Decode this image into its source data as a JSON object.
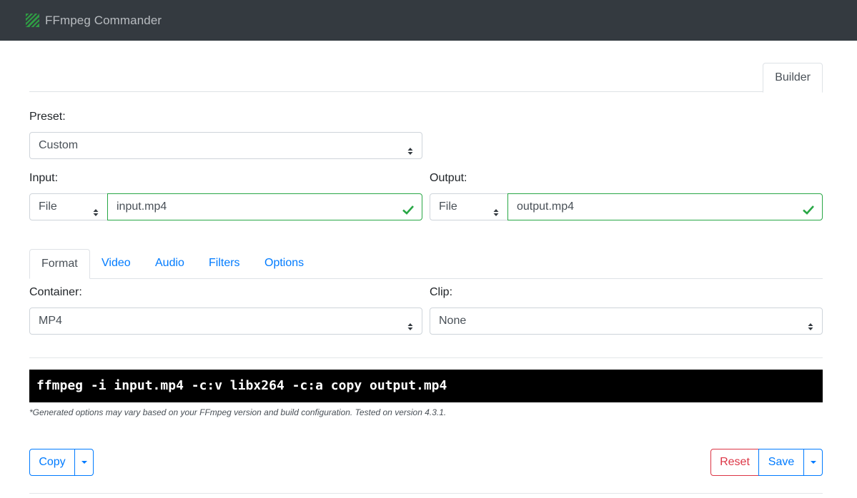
{
  "app": {
    "title": "FFmpeg Commander"
  },
  "top_tabs": {
    "builder": "Builder"
  },
  "preset": {
    "label": "Preset:",
    "value": "Custom"
  },
  "input": {
    "label": "Input:",
    "type": "File",
    "value": "input.mp4"
  },
  "output": {
    "label": "Output:",
    "type": "File",
    "value": "output.mp4"
  },
  "tabs": [
    {
      "label": "Format",
      "active": true
    },
    {
      "label": "Video",
      "active": false
    },
    {
      "label": "Audio",
      "active": false
    },
    {
      "label": "Filters",
      "active": false
    },
    {
      "label": "Options",
      "active": false
    }
  ],
  "format": {
    "container_label": "Container:",
    "container_value": "MP4",
    "clip_label": "Clip:",
    "clip_value": "None"
  },
  "command": "ffmpeg -i input.mp4 -c:v libx264 -c:a copy output.mp4",
  "note": "*Generated options may vary based on your FFmpeg version and build configuration. Tested on version 4.3.1.",
  "buttons": {
    "copy": "Copy",
    "reset": "Reset",
    "save": "Save"
  },
  "colors": {
    "navbar": "#343a40",
    "primary": "#007bff",
    "success": "#28a745",
    "danger": "#dc3545"
  },
  "icons": {
    "logo": "ffmpeg-logo-icon",
    "select_arrows": "sort-arrows-icon",
    "valid": "check-icon",
    "dropdown": "caret-down-icon"
  }
}
